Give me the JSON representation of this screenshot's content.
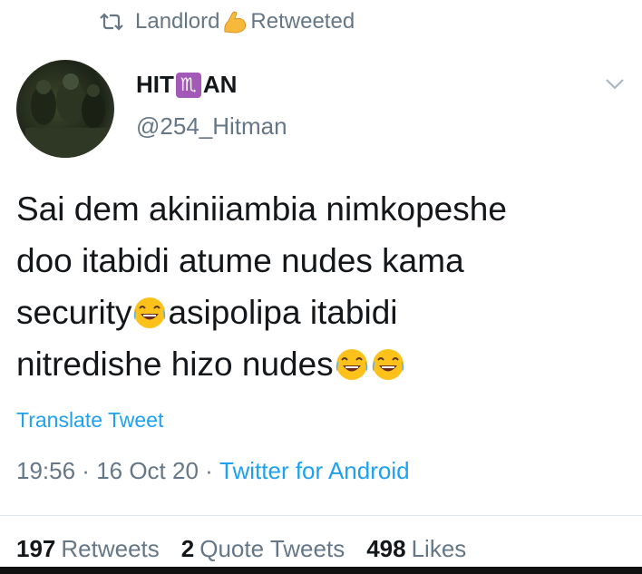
{
  "retweet": {
    "user": "Landlord",
    "emoji": "flexed-biceps-icon",
    "label": "Retweeted"
  },
  "author": {
    "name_prefix": "HIT",
    "name_symbol": "♏",
    "name_suffix": "AN",
    "handle": "@254_Hitman"
  },
  "tweet": {
    "lines": [
      "Sai dem akiniiambia nimkopeshe",
      "doo itabidi atume nudes  kama",
      "security",
      "asipolipa itabidi",
      "nitredishe hizo nudes"
    ],
    "emoji": "face-with-tears-of-joy-icon"
  },
  "translate_label": "Translate Tweet",
  "meta": {
    "time": "19:56",
    "sep1": " · ",
    "date": "16 Oct 20",
    "sep2": " · ",
    "source": "Twitter for Android"
  },
  "stats": {
    "retweets_count": "197",
    "retweets_label": "Retweets",
    "quotes_count": "2",
    "quotes_label": "Quote Tweets",
    "likes_count": "498",
    "likes_label": "Likes"
  },
  "colors": {
    "link": "#1da1f2",
    "muted": "#657786",
    "text": "#14171a"
  }
}
